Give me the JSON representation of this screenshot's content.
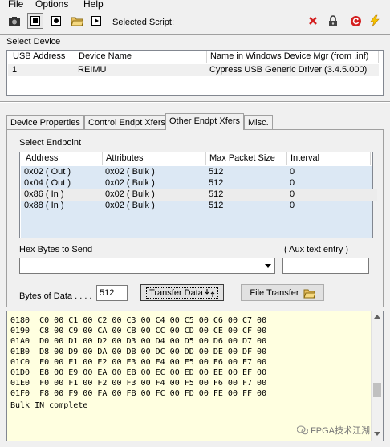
{
  "menu": {
    "items": [
      "File",
      "Options",
      "Help"
    ]
  },
  "toolbar": {
    "selected_script_label": "Selected Script:"
  },
  "device_section": {
    "label": "Select Device",
    "columns": [
      "USB Address",
      "Device Name",
      "Name in Windows Device Mgr (from .inf)"
    ],
    "rows": [
      {
        "usb_address": "1",
        "device_name": "REIMU",
        "windows_name": "Cypress USB Generic Driver (3.4.5.000)"
      }
    ]
  },
  "tabs": [
    "Device Properties",
    "Control Endpt Xfers",
    "Other Endpt Xfers",
    "Misc."
  ],
  "active_tab": "Other Endpt Xfers",
  "endpoint_section": {
    "label": "Select Endpoint",
    "columns": [
      "Address",
      "Attributes",
      "Max Packet Size",
      "Interval"
    ],
    "rows": [
      {
        "address": "0x02 ( Out )",
        "attributes": "0x02  ( Bulk )",
        "max_packet": "512",
        "interval": "0"
      },
      {
        "address": "0x04 ( Out )",
        "attributes": "0x02  ( Bulk )",
        "max_packet": "512",
        "interval": "0"
      },
      {
        "address": "0x86 ( In )",
        "attributes": "0x02  ( Bulk )",
        "max_packet": "512",
        "interval": "0"
      },
      {
        "address": "0x88 ( In )",
        "attributes": "0x02  ( Bulk )",
        "max_packet": "512",
        "interval": "0"
      }
    ]
  },
  "hex_bytes": {
    "label": "Hex Bytes to Send",
    "value": ""
  },
  "aux_text": {
    "label": "( Aux text entry )",
    "value": ""
  },
  "bytes_of_data": {
    "label": "Bytes of Data . . . .",
    "value": "512"
  },
  "buttons": {
    "transfer_data": "Transfer Data",
    "file_transfer": "File Transfer"
  },
  "output_lines": [
    "0180  C0 00 C1 00 C2 00 C3 00 C4 00 C5 00 C6 00 C7 00",
    "0190  C8 00 C9 00 CA 00 CB 00 CC 00 CD 00 CE 00 CF 00",
    "01A0  D0 00 D1 00 D2 00 D3 00 D4 00 D5 00 D6 00 D7 00",
    "01B0  D8 00 D9 00 DA 00 DB 00 DC 00 DD 00 DE 00 DF 00",
    "01C0  E0 00 E1 00 E2 00 E3 00 E4 00 E5 00 E6 00 E7 00",
    "01D0  E8 00 E9 00 EA 00 EB 00 EC 00 ED 00 EE 00 EF 00",
    "01E0  F0 00 F1 00 F2 00 F3 00 F4 00 F5 00 F6 00 F7 00",
    "01F0  F8 00 F9 00 FA 00 FB 00 FC 00 FD 00 FE 00 FF 00",
    "Bulk IN complete"
  ],
  "watermark": "FPGA技术江湖",
  "colors": {
    "selection_blue": "#dce8f4",
    "output_bg": "#ffffe0",
    "stop_red": "#d42020",
    "lightning_yellow": "#f5c400"
  }
}
